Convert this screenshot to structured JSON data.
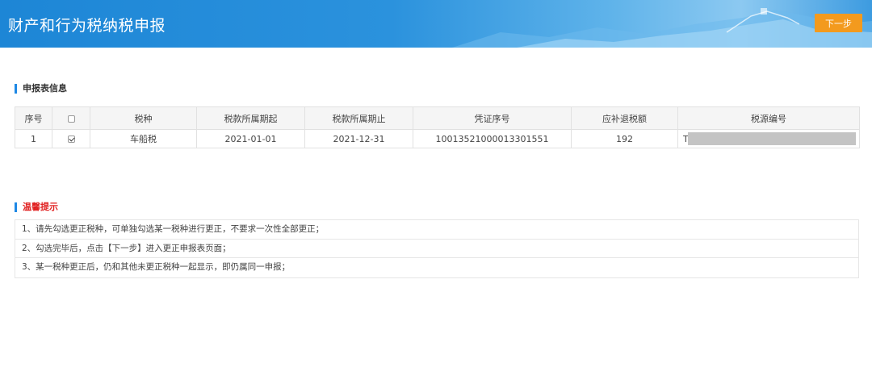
{
  "header": {
    "title": "财产和行为税纳税申报",
    "next_label": "下一步",
    "colors": {
      "banner": "#2b92dd",
      "next_button": "#f39a1e"
    }
  },
  "report_section": {
    "title": "申报表信息",
    "columns": [
      "序号",
      "",
      "税种",
      "税款所属期起",
      "税款所属期止",
      "凭证序号",
      "应补退税额",
      "税源编号"
    ],
    "rows": [
      {
        "index": "1",
        "checked": true,
        "tax_type": "车船税",
        "period_start": "2021-01-01",
        "period_end": "2021-12-31",
        "voucher_no": "10013521000013301551",
        "amount": "192",
        "source_no": "T"
      }
    ]
  },
  "tips_section": {
    "title": "温馨提示",
    "items": [
      "1、请先勾选更正税种，可单独勾选某一税种进行更正，不要求一次性全部更正；",
      "2、勾选完毕后，点击【下一步】进入更正申报表页面；",
      "3、某一税种更正后，仍和其他未更正税种一起显示，即仍属同一申报；"
    ],
    "color": "#e02020"
  }
}
